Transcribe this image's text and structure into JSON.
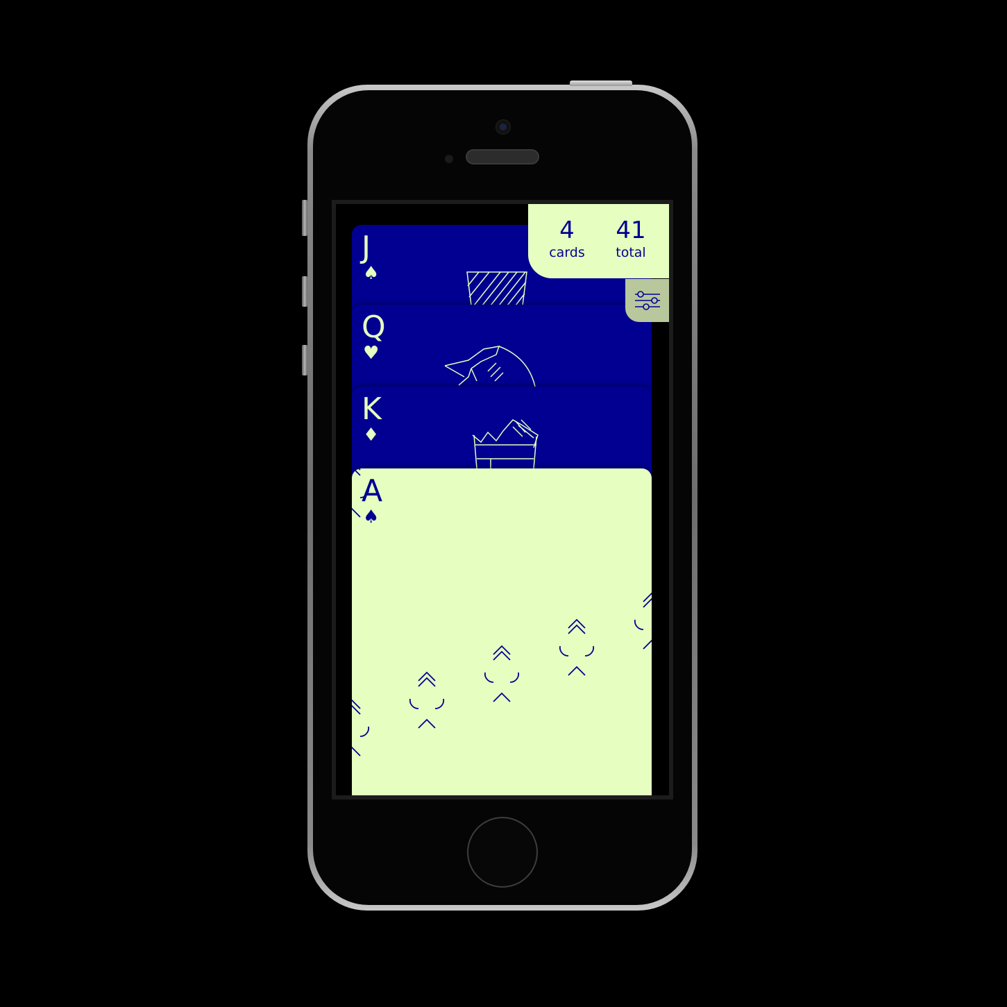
{
  "cards": [
    {
      "rank": "J",
      "suit": "♠",
      "suit_name": "spades",
      "face_art": "jack-hat-icon"
    },
    {
      "rank": "Q",
      "suit": "♥",
      "suit_name": "hearts",
      "face_art": "queen-profile-icon"
    },
    {
      "rank": "K",
      "suit": "♦",
      "suit_name": "diamonds",
      "face_art": "king-crown-icon"
    },
    {
      "rank": "A",
      "suit": "♠",
      "suit_name": "spades",
      "face_art": "ace-spade-pattern"
    }
  ],
  "counters": {
    "cards_value": "4",
    "cards_label": "cards",
    "total_value": "41",
    "total_label": "total"
  },
  "settings": {
    "icon": "sliders-icon"
  },
  "colors": {
    "card_dark": "#010090",
    "card_light": "#e6ffc1",
    "settings_bg": "#b9c89c"
  }
}
